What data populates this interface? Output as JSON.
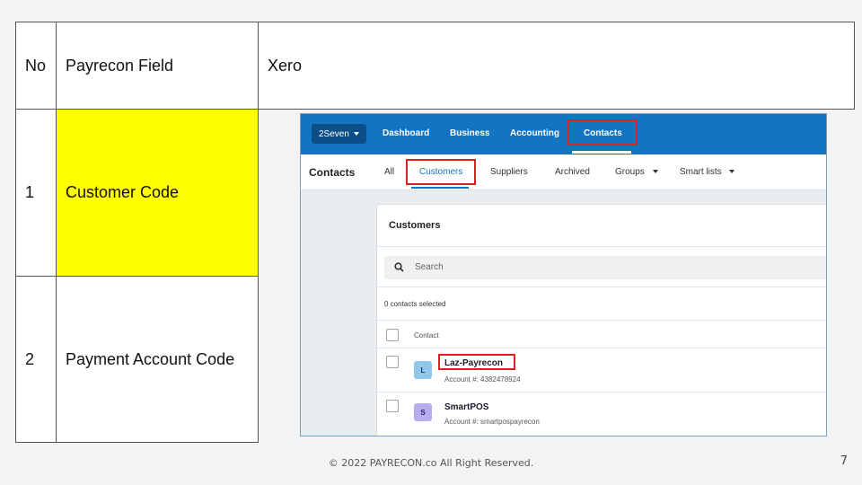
{
  "table": {
    "headers": [
      "No",
      "Payrecon Field",
      "Xero"
    ],
    "rows": [
      {
        "no": "1",
        "field": "Customer Code"
      },
      {
        "no": "2",
        "field": "Payment Account Code"
      }
    ]
  },
  "xero": {
    "org": "2Seven",
    "nav": [
      "Dashboard",
      "Business",
      "Accounting",
      "Contacts"
    ],
    "subnav": {
      "title": "Contacts",
      "items": [
        "All",
        "Customers",
        "Suppliers",
        "Archived",
        "Groups",
        "Smart lists"
      ]
    },
    "panel_title": "Customers",
    "search_placeholder": "Search",
    "selected_text": "0 contacts selected",
    "column_header": "Contact",
    "contacts": [
      {
        "initial": "L",
        "name": "Laz-Payrecon",
        "account": "Account #: 4382478924"
      },
      {
        "initial": "S",
        "name": "SmartPOS",
        "account": "Account #: smartpospayrecon"
      }
    ]
  },
  "footer": "© 2022 PAYRECON.co All Right Reserved.",
  "page_number": "7",
  "colors": {
    "highlight": "#ffff00",
    "xero_blue": "#1474c4",
    "annotation_red": "#e02020"
  }
}
